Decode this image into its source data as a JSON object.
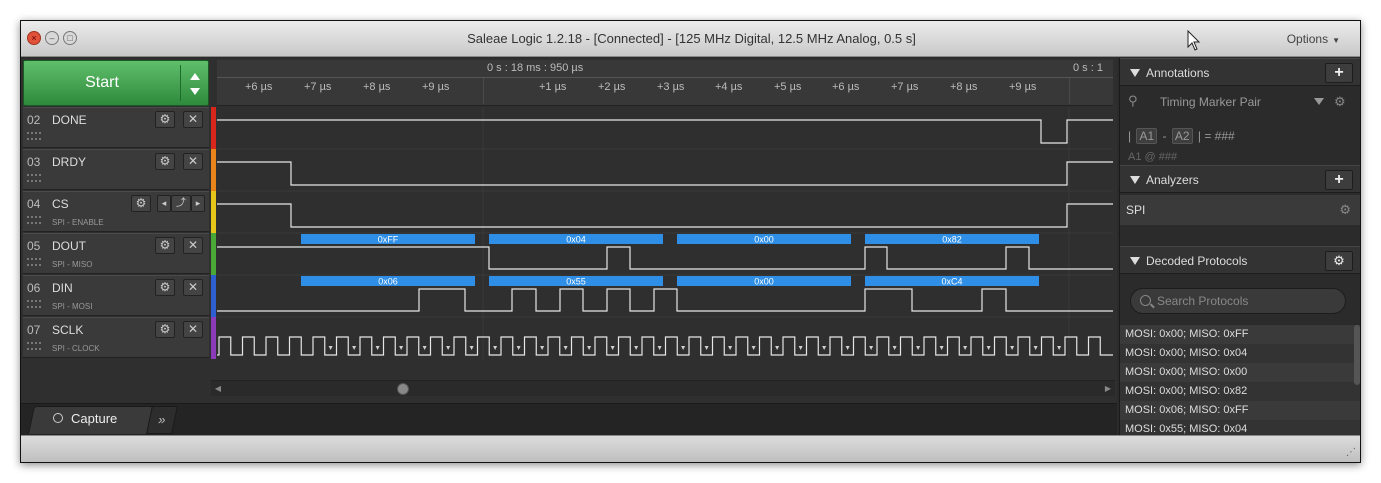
{
  "window": {
    "title": "Saleae Logic 1.2.18 - [Connected] - [125 MHz Digital, 12.5 MHz Analog, 0.5 s]",
    "options_label": "Options",
    "close_glyph": "×",
    "min_glyph": "–",
    "max_glyph": "□"
  },
  "start": {
    "label": "Start"
  },
  "timeline": {
    "top_label_1": "0 s : 18 ms : 950 µs",
    "top_label_2": "0 s : 1",
    "ticks": [
      "+6 µs",
      "+7 µs",
      "+8 µs",
      "+9 µs",
      "+1 µs",
      "+2 µs",
      "+3 µs",
      "+4 µs",
      "+5 µs",
      "+6 µs",
      "+7 µs",
      "+8 µs",
      "+9 µs"
    ]
  },
  "channels": [
    {
      "num": "02",
      "name": "DONE",
      "sub": "",
      "color": "#d9261c"
    },
    {
      "num": "03",
      "name": "DRDY",
      "sub": "",
      "color": "#e8841a"
    },
    {
      "num": "04",
      "name": "CS",
      "sub": "SPI - ENABLE",
      "color": "#e6c619"
    },
    {
      "num": "05",
      "name": "DOUT",
      "sub": "SPI - MISO",
      "color": "#4aa837"
    },
    {
      "num": "06",
      "name": "DIN",
      "sub": "SPI - MOSI",
      "color": "#2d5fd1"
    },
    {
      "num": "07",
      "name": "SCLK",
      "sub": "SPI - CLOCK",
      "color": "#8b3bb8"
    }
  ],
  "channel_buttons": {
    "gear": "⚙",
    "close": "✕",
    "prev": "◂",
    "edge": "⤴",
    "next": "▸"
  },
  "decoded_bytes": {
    "dout": [
      "0xFF",
      "0x04",
      "0x00",
      "0x82"
    ],
    "din": [
      "0x06",
      "0x55",
      "0x00",
      "0xC4"
    ]
  },
  "tabs": {
    "capture": "Capture",
    "more": "»"
  },
  "annotations": {
    "title": "Annotations",
    "add": "+",
    "marker_label": "Timing Marker Pair",
    "gear": "⚙",
    "line1": {
      "sep1": "|",
      "a1": "A1",
      "dash": "-",
      "a2": "A2",
      "sep2": "| = ###"
    },
    "line2": "A1  @  ###"
  },
  "analyzers": {
    "title": "Analyzers",
    "add": "+",
    "items": [
      {
        "label": "SPI"
      }
    ]
  },
  "decoded_protocols": {
    "title": "Decoded Protocols",
    "search_placeholder": "Search Protocols",
    "rows": [
      "MOSI: 0x00;  MISO: 0xFF",
      "MOSI: 0x00;  MISO: 0x04",
      "MOSI: 0x00;  MISO: 0x00",
      "MOSI: 0x00;  MISO: 0x82",
      "MOSI: 0x06;  MISO: 0xFF",
      "MOSI: 0x55;  MISO: 0x04"
    ]
  },
  "statusbar": {
    "resize_glyph": "⋰"
  }
}
